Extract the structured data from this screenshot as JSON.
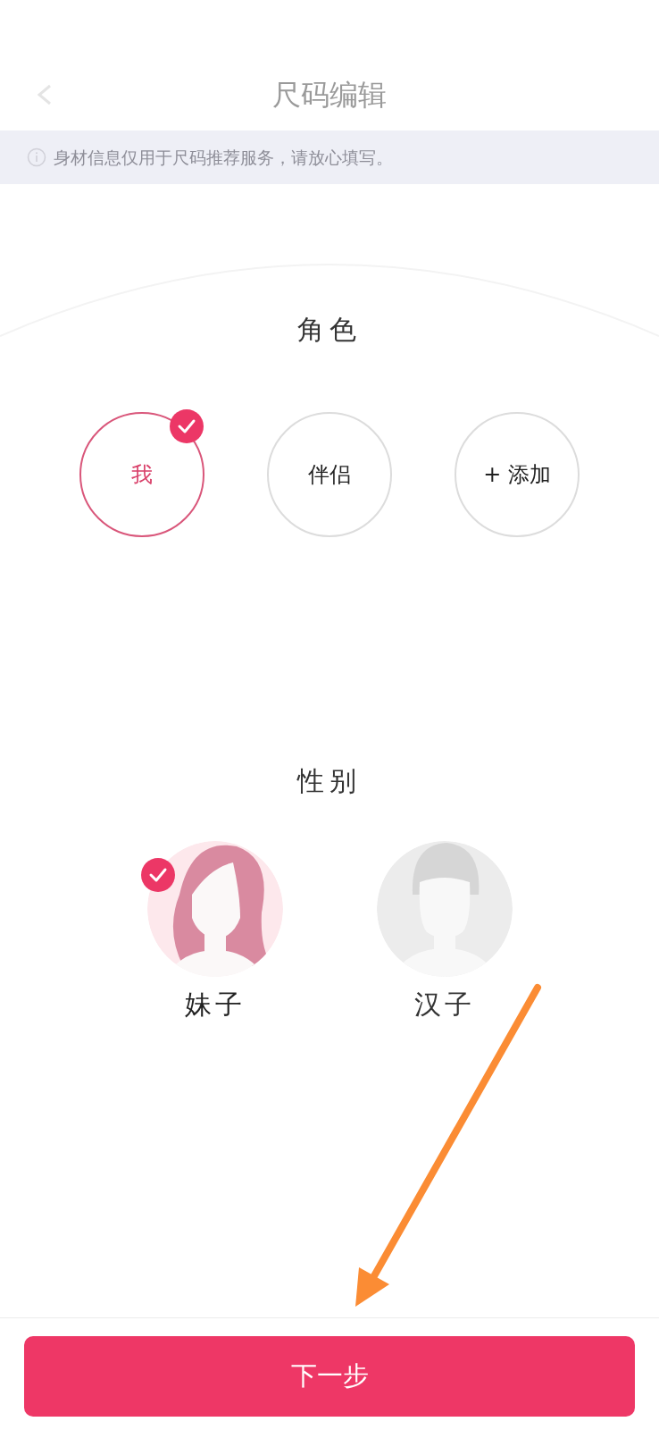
{
  "header": {
    "title": "尺码编辑"
  },
  "notice": {
    "text": "身材信息仅用于尺码推荐服务，请放心填写。"
  },
  "role": {
    "label": "角色",
    "options": [
      {
        "label": "我",
        "selected": true
      },
      {
        "label": "伴侣",
        "selected": false
      },
      {
        "label": "+ 添加",
        "selected": false
      }
    ]
  },
  "gender": {
    "label": "性别",
    "options": [
      {
        "label": "妹子",
        "kind": "female",
        "selected": true
      },
      {
        "label": "汉子",
        "kind": "male",
        "selected": false
      }
    ]
  },
  "next_button": {
    "label": "下一步"
  }
}
